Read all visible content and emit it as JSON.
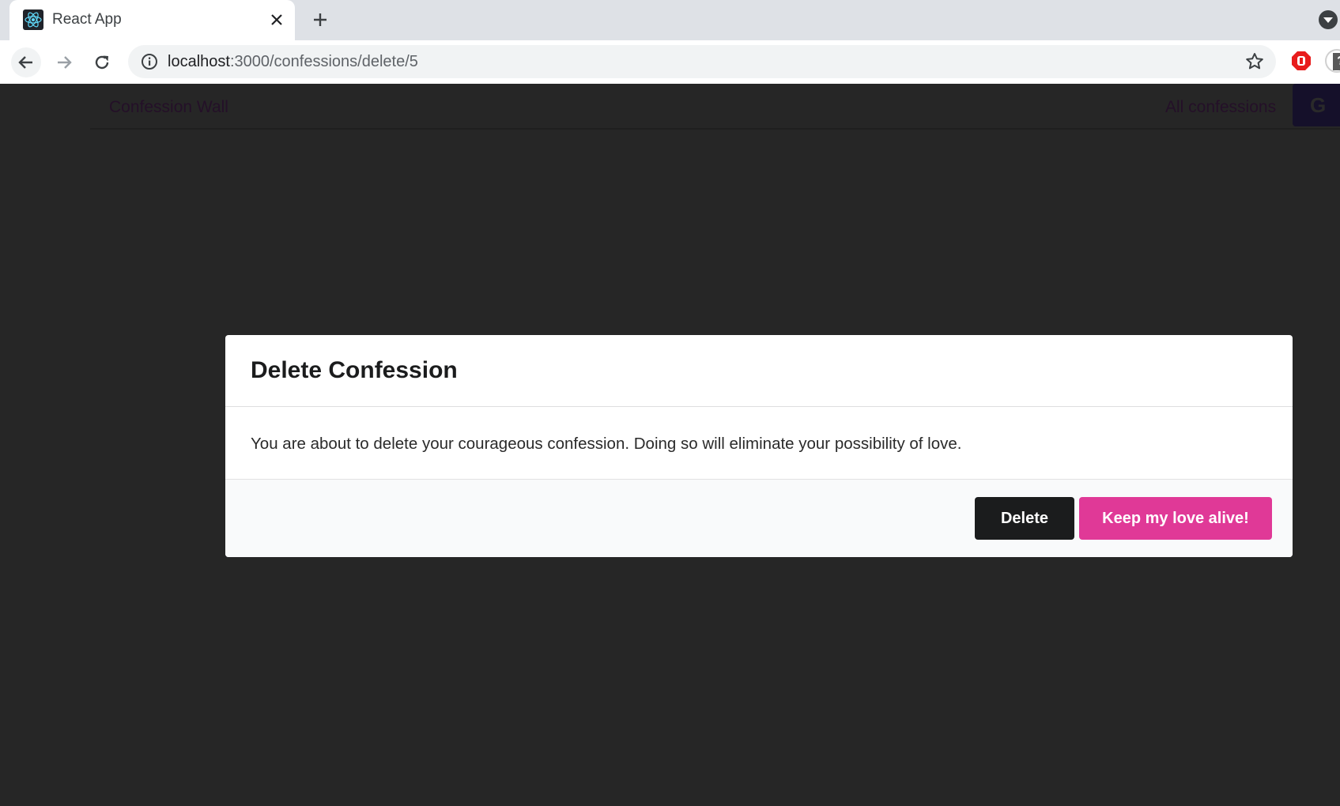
{
  "browser": {
    "tab_title": "React App",
    "url_host": "localhost",
    "url_path": ":3000/confessions/delete/5"
  },
  "navbar": {
    "brand": "Confession Wall",
    "all_confessions": "All confessions",
    "google_letter": "G"
  },
  "modal": {
    "title": "Delete Confession",
    "message": "You are about to delete your courageous confession. Doing so will eliminate your possibility of love.",
    "delete_label": "Delete",
    "keep_label": "Keep my love alive!"
  },
  "colors": {
    "page_background": "#262626",
    "delete_button": "#1b1c1d",
    "keep_button": "#e03997",
    "modal_actions_background": "#f9fafb"
  },
  "icons": {
    "favicon": "react-logo-icon",
    "close": "close-icon",
    "new_tab": "plus-icon",
    "back": "arrow-left-icon",
    "forward": "arrow-right-icon",
    "reload": "reload-icon",
    "info": "info-icon",
    "bookmark": "star-icon",
    "extension": "adblock-icon"
  }
}
